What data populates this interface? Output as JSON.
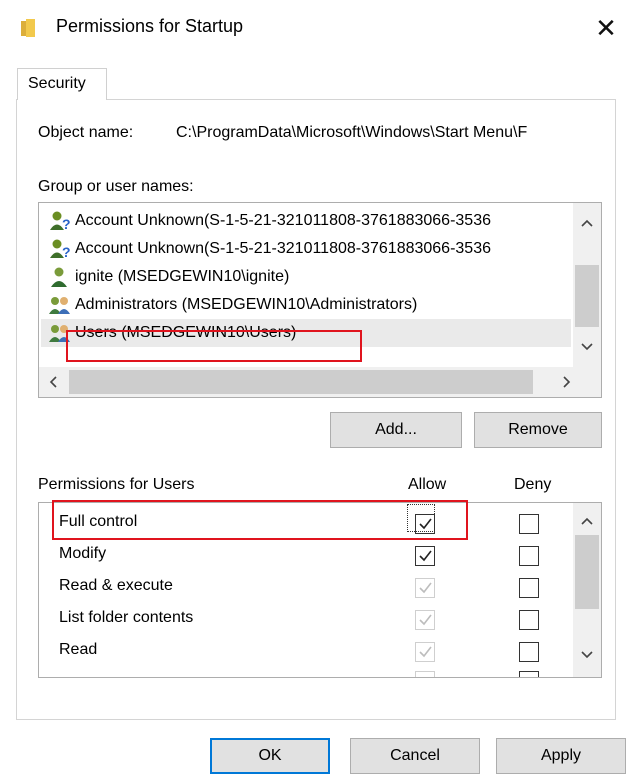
{
  "window": {
    "title": "Permissions for Startup",
    "close_glyph": "✕"
  },
  "tabs": [
    {
      "label": "Security",
      "active": true
    }
  ],
  "object_name": {
    "label": "Object name:",
    "value": "C:\\ProgramData\\Microsoft\\Windows\\Start Menu\\F"
  },
  "group_label": "Group or user names:",
  "users": [
    {
      "name": "Account Unknown(S-1-5-21-321011808-3761883066-3536",
      "icon": "unknown-user-icon"
    },
    {
      "name": "Account Unknown(S-1-5-21-321011808-3761883066-3536",
      "icon": "unknown-user-icon"
    },
    {
      "name": "ignite (MSEDGEWIN10\\ignite)",
      "icon": "user-icon"
    },
    {
      "name": "Administrators (MSEDGEWIN10\\Administrators)",
      "icon": "group-icon"
    },
    {
      "name": "Users (MSEDGEWIN10\\Users)",
      "icon": "group-icon",
      "selected": true
    }
  ],
  "buttons": {
    "add": "Add...",
    "remove": "Remove",
    "ok": "OK",
    "cancel": "Cancel",
    "apply": "Apply"
  },
  "permissions_header": {
    "title": "Permissions for Users",
    "allow": "Allow",
    "deny": "Deny"
  },
  "permissions": [
    {
      "name": "Full control",
      "allow": true,
      "allow_disabled": false,
      "deny": false
    },
    {
      "name": "Modify",
      "allow": true,
      "allow_disabled": false,
      "deny": false
    },
    {
      "name": "Read & execute",
      "allow": true,
      "allow_disabled": true,
      "deny": false
    },
    {
      "name": "List folder contents",
      "allow": true,
      "allow_disabled": true,
      "deny": false
    },
    {
      "name": "Read",
      "allow": true,
      "allow_disabled": true,
      "deny": false
    }
  ],
  "colors": {
    "highlight": "#e0141e",
    "folder": "#f2c94c",
    "selection": "#eaeaea"
  }
}
